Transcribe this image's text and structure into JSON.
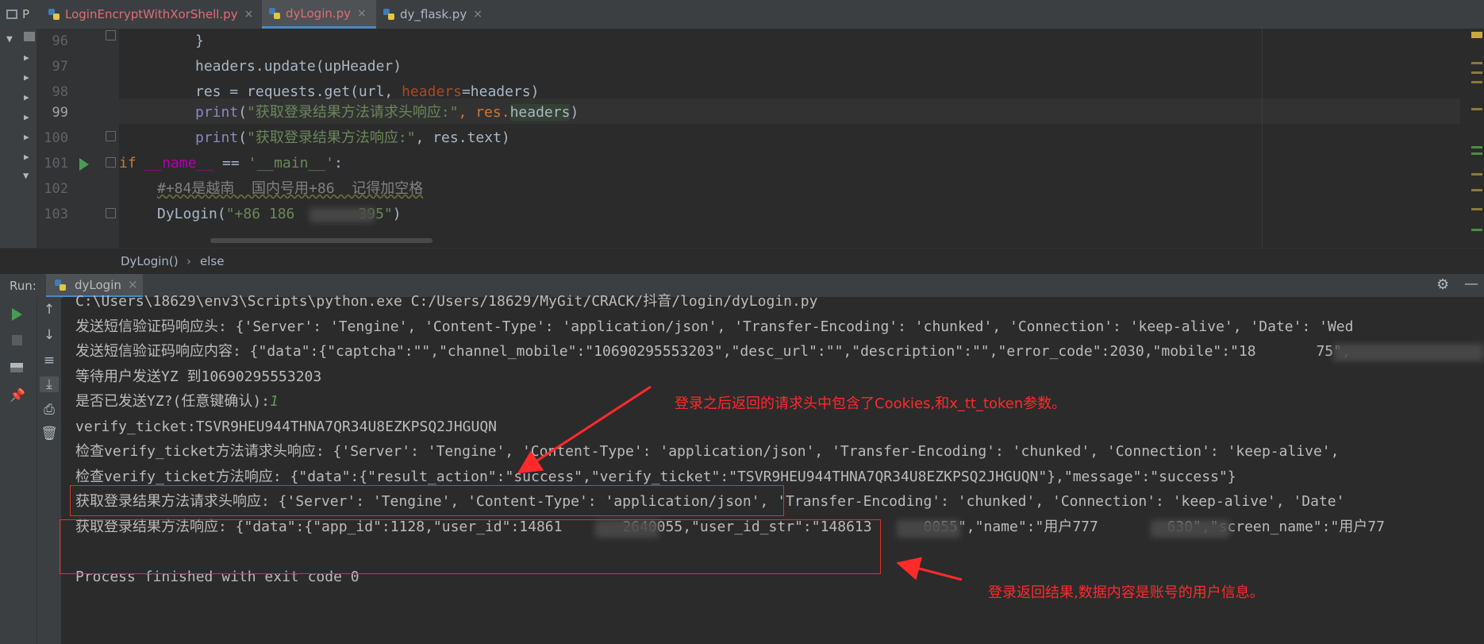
{
  "tabs": [
    {
      "label": "P",
      "active": false,
      "color": "#bbbbbb"
    },
    {
      "label": "LoginEncryptWithXorShell.py",
      "active": false,
      "color": "#e06c75"
    },
    {
      "label": "dyLogin.py",
      "active": true,
      "color": "#e06c75"
    },
    {
      "label": "dy_flask.py",
      "active": false,
      "color": "#a9b7c6"
    }
  ],
  "editor": {
    "line_numbers": [
      "96",
      "97",
      "98",
      "99",
      "100",
      "101",
      "102",
      "103"
    ],
    "current_line": "99",
    "lines": {
      "l96": "}",
      "l97": "headers.update(upHeader)",
      "l98_a": "res = requests.get(url, ",
      "l98_b": "headers",
      "l98_c": "=headers)",
      "l99_a": "print",
      "l99_b": "(",
      "l99_c": "\"获取登录结果方法请求头响应:\"",
      "l99_d": ", res.",
      "l99_e": "headers",
      "l99_f": ")",
      "l100_a": "print",
      "l100_b": "(",
      "l100_c": "\"获取登录结果方法响应:\"",
      "l100_d": ", res.text)",
      "l101_a": "if ",
      "l101_b": "__name__",
      "l101_c": " == ",
      "l101_d": "'__main__'",
      "l101_e": ":",
      "l102": "#+84是越南  国内号用+86  记得加空格",
      "l103_a": "DyLogin(",
      "l103_b": "\"+86 186",
      "l103_c": "395\"",
      "l103_d": ")"
    }
  },
  "breadcrumb": {
    "item1": "DyLogin()",
    "sep": "›",
    "item2": "else"
  },
  "run": {
    "label": "Run:",
    "tab_label": "dyLogin",
    "close": "×"
  },
  "console": {
    "l1": "C:\\Users\\18629\\env3\\Scripts\\python.exe C:/Users/18629/MyGit/CRACK/抖音/login/dyLogin.py",
    "l2": "发送短信验证码响应头: {'Server': 'Tengine', 'Content-Type': 'application/json', 'Transfer-Encoding': 'chunked', 'Connection': 'keep-alive', 'Date': 'Wed",
    "l3": "发送短信验证码响应内容: {\"data\":{\"captcha\":\"\",\"channel_mobile\":\"10690295553203\",\"desc_url\":\"\",\"description\":\"\",\"error_code\":2030,\"mobile\":\"18       75\",",
    "l4": "等待用户发送YZ 到10690295553203",
    "l5_a": "是否已发送YZ?(任意键确认):",
    "l5_b": "1",
    "l6": "verify_ticket:TSVR9HEU944THNA7QR34U8EZKPSQ2JHGUQN",
    "l7": "检查verify_ticket方法请求头响应: {'Server': 'Tengine', 'Content-Type': 'application/json', 'Transfer-Encoding': 'chunked', 'Connection': 'keep-alive',",
    "l8": "检查verify_ticket方法响应: {\"data\":{\"result_action\":\"success\",\"verify_ticket\":\"TSVR9HEU944THNA7QR34U8EZKPSQ2JHGUQN\"},\"message\":\"success\"}",
    "l9": "获取登录结果方法请求头响应: {'Server': 'Tengine', 'Content-Type': 'application/json', 'Transfer-Encoding': 'chunked', 'Connection': 'keep-alive', 'Date'",
    "l10": "获取登录结果方法响应: {\"data\":{\"app_id\":1128,\"user_id\":14861       2640055,\"user_id_str\":\"148613      0055\",\"name\":\"用户777        630\",\"screen_name\":\"用户77",
    "l11": "Process finished with exit code 0"
  },
  "annotations": {
    "top": "登录之后返回的请求头中包含了Cookies,和x_tt_token参数。",
    "bottom": "登录返回结果,数据内容是账号的用户信息。"
  },
  "colors": {
    "annotation": "#ff2a2a",
    "run_green": "#499c54"
  }
}
